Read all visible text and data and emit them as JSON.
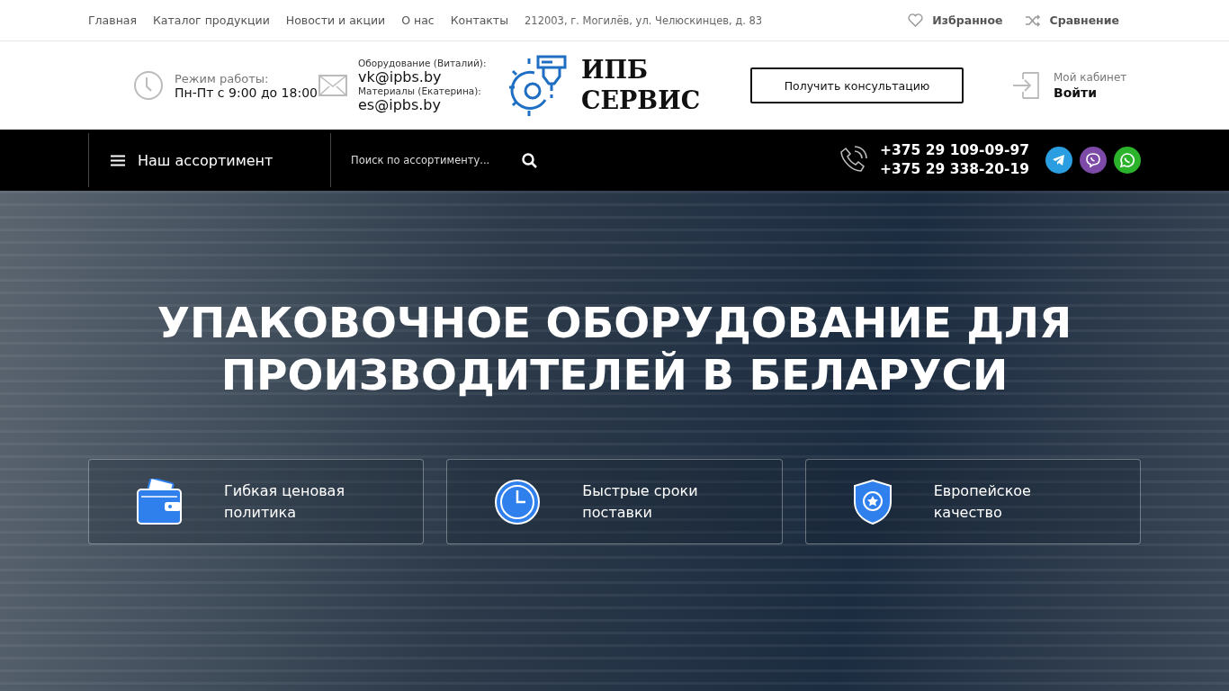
{
  "top_nav": {
    "links": [
      "Главная",
      "Каталог продукции",
      "Новости и акции",
      "О нас",
      "Контакты"
    ],
    "address": "212003, г. Могилёв, ул. Челюскинцев, д. 83",
    "favorites": "Избранное",
    "compare": "Сравнение"
  },
  "header": {
    "hours_label": "Режим работы:",
    "hours": "Пн-Пт с 9:00 до 18:00",
    "contacts": [
      {
        "label": "Оборудование (Виталий):",
        "email": "vk@ipbs.by"
      },
      {
        "label": "Материалы (Екатерина):",
        "email": "es@ipbs.by"
      }
    ],
    "logo_lines": [
      "ИПБ",
      "СЕРВИС"
    ],
    "consult_button": "Получить консультацию",
    "account_label": "Мой кабинет",
    "login": "Войти"
  },
  "nav": {
    "menu": "Наш ассортимент",
    "search": {
      "placeholder": "Поиск по ассортименту..."
    },
    "phones": [
      "+375 29 109-09-97",
      "+375 29 338-20-19"
    ],
    "messengers": [
      {
        "kind": "telegram",
        "color": "#2a9ee0"
      },
      {
        "kind": "viber",
        "color": "#7d4aa8"
      },
      {
        "kind": "whatsapp",
        "color": "#2bb32b"
      }
    ]
  },
  "hero": {
    "title": "УПАКОВОЧНОЕ ОБОРУДОВАНИЕ ДЛЯ\nПРОИЗВОДИТЕЛЕЙ В БЕЛАРУСИ",
    "features": [
      {
        "kind": "wallet",
        "text": "Гибкая ценовая\nполитика"
      },
      {
        "kind": "clock",
        "text": "Быстрые сроки\nпоставки"
      },
      {
        "kind": "shield",
        "text": "Европейское\nкачество"
      }
    ]
  }
}
